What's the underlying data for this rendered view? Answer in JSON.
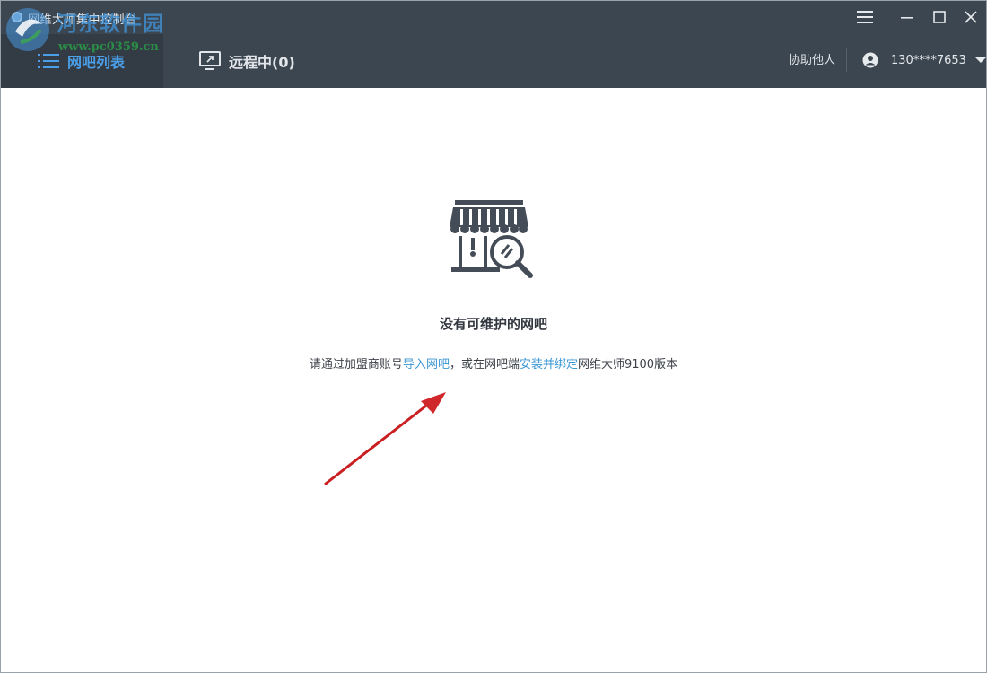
{
  "window": {
    "title": "网维大师集中控制台"
  },
  "watermark": {
    "text": "河东软件园",
    "url": "www.pc0359.cn"
  },
  "tabs": [
    {
      "label": "网吧列表",
      "icon": "list-icon",
      "active": true
    },
    {
      "label": "远程中(0)",
      "icon": "remote-desktop-icon",
      "active": false
    }
  ],
  "header": {
    "assist_label": "协助他人",
    "user_name": "130****7653",
    "user_icon": "user-avatar-icon",
    "dropdown_icon": "caret-down-icon"
  },
  "empty_state": {
    "icon": "store-search-icon",
    "title": "没有可维护的网吧",
    "desc_part1": "请通过加盟商账号",
    "link1": "导入网吧",
    "desc_part2": "，或在网吧端",
    "link2": "安装并绑定",
    "desc_part3": "网维大师9100版本"
  },
  "colors": {
    "titlebar": "#3c4650",
    "active_tab_bg": "#333c45",
    "accent": "#4a9fe8",
    "link": "#3b97d3",
    "annotation_arrow": "#d0282a"
  }
}
